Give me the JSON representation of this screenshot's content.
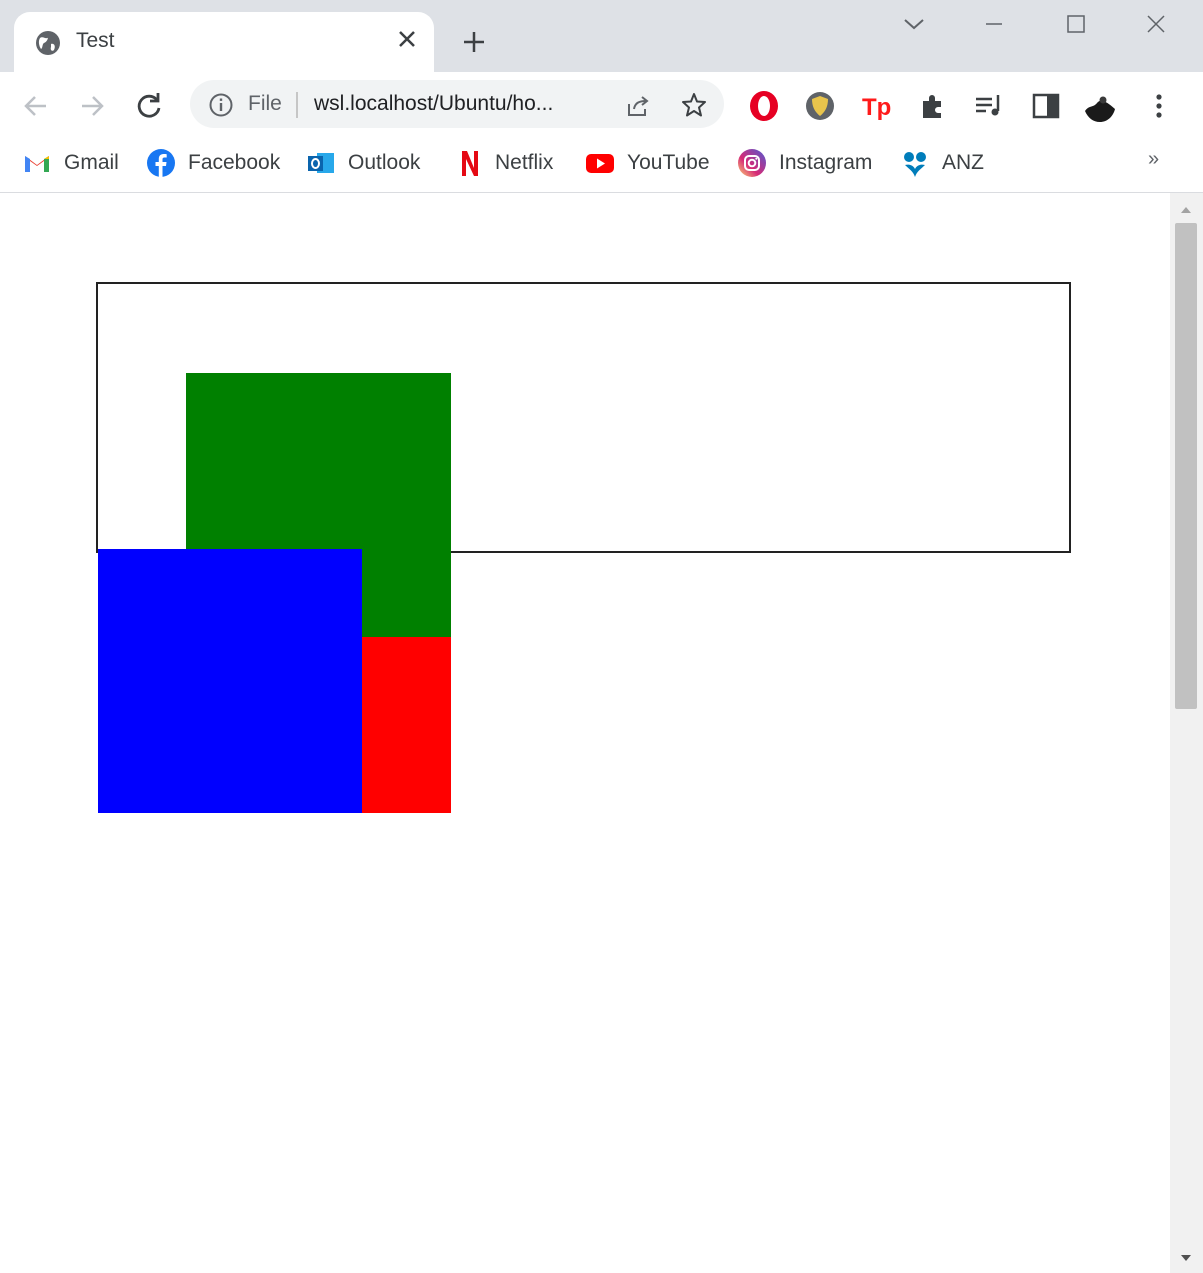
{
  "tab": {
    "title": "Test"
  },
  "omnibox": {
    "scheme_label": "File",
    "url": "wsl.localhost/Ubuntu/ho..."
  },
  "bookmarks": [
    {
      "label": "Gmail",
      "icon": "gmail-icon"
    },
    {
      "label": "Facebook",
      "icon": "facebook-icon"
    },
    {
      "label": "Outlook",
      "icon": "outlook-icon"
    },
    {
      "label": "Netflix",
      "icon": "netflix-icon"
    },
    {
      "label": "YouTube",
      "icon": "youtube-icon"
    },
    {
      "label": "Instagram",
      "icon": "instagram-icon"
    },
    {
      "label": "ANZ",
      "icon": "anz-icon"
    }
  ],
  "bookmarks_overflow": "»",
  "colors": {
    "square_red": "#ff0000",
    "square_green": "#008000",
    "square_blue": "#0000ff",
    "box_border": "#222222"
  }
}
